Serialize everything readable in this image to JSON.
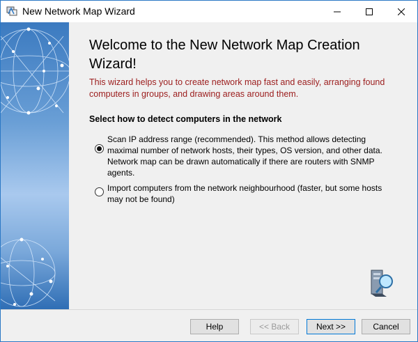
{
  "window": {
    "title": "New Network Map Wizard",
    "accent_color": "#2b78c5",
    "controls": {
      "minimize_icon": "minimize-icon",
      "maximize_icon": "maximize-icon",
      "close_icon": "close-icon"
    }
  },
  "main": {
    "heading": "Welcome to the New Network Map Creation Wizard!",
    "intro": "This wizard helps you to create network map fast and easily, arranging found computers in groups, and drawing areas around them.",
    "intro_color": "#9b1c1c",
    "section_title": "Select how to detect computers in the network",
    "options": [
      {
        "label": "Scan IP address range (recommended). This method allows detecting maximal number of network hosts, their types, OS version, and other data. Network map can be drawn automatically if there are routers with SNMP agents.",
        "checked": true
      },
      {
        "label": "Import computers from the network neighbourhood (faster, but some hosts may not be found)",
        "checked": false
      }
    ]
  },
  "footer": {
    "help_label": "Help",
    "back_label": "<< Back",
    "back_enabled": false,
    "next_label": "Next >>",
    "cancel_label": "Cancel"
  }
}
